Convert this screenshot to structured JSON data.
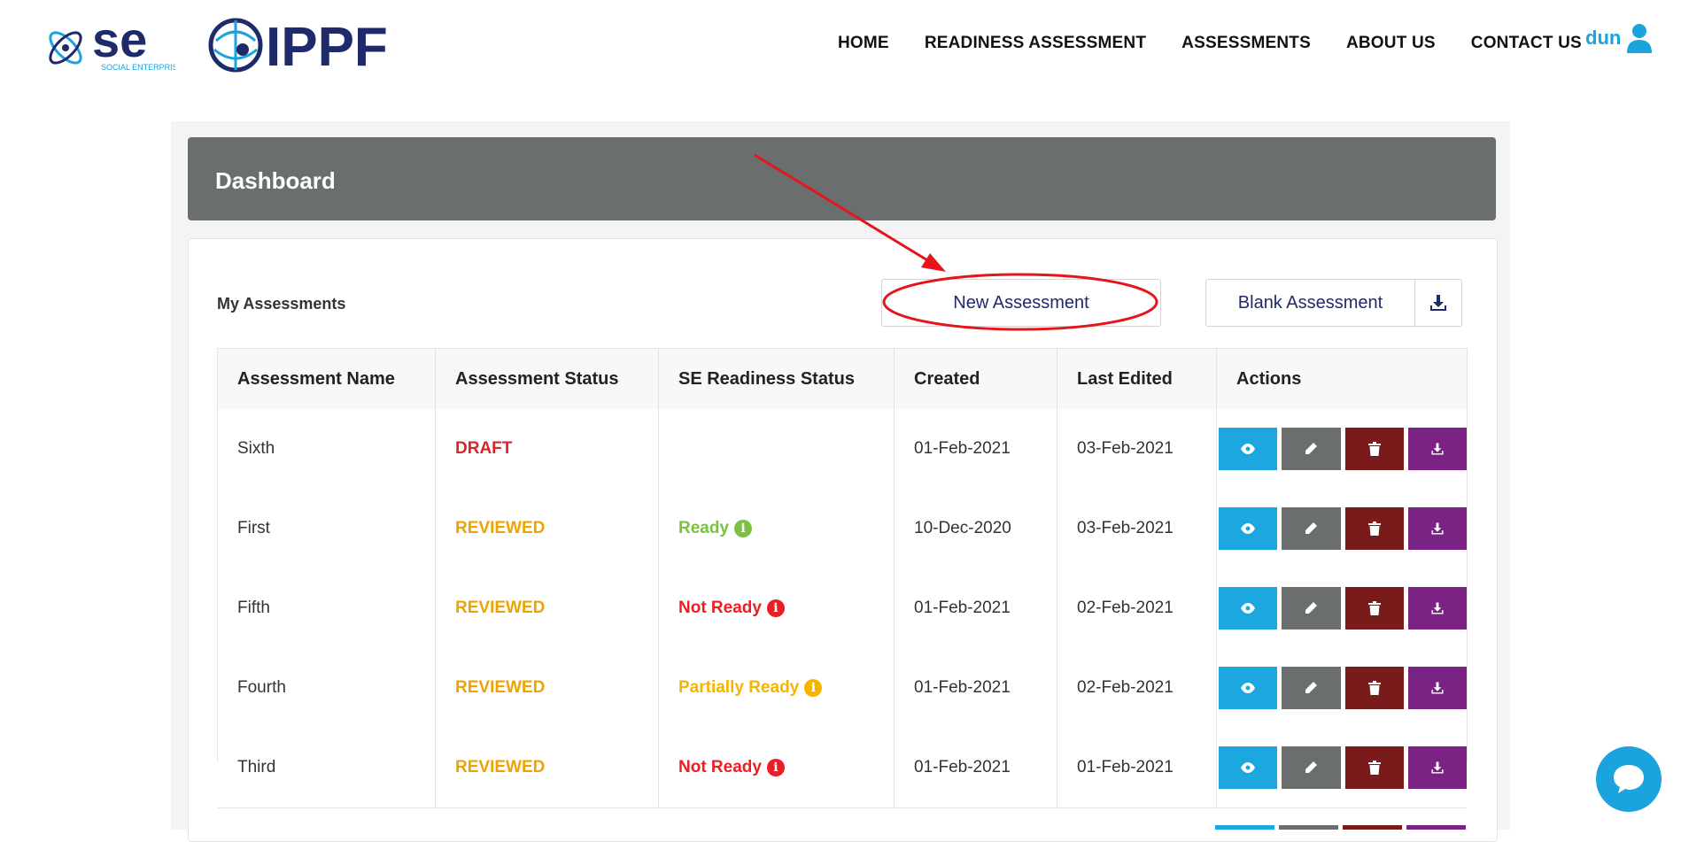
{
  "header": {
    "logo_se_text": "se",
    "logo_se_sub": "SOCIAL ENTERPRISE",
    "logo_ippf_text": "IPPF",
    "nav": [
      "HOME",
      "READINESS ASSESSMENT",
      "ASSESSMENTS",
      "ABOUT US",
      "CONTACT US"
    ],
    "user_name": "dun"
  },
  "dashboard": {
    "title": "Dashboard",
    "section_label": "My Assessments",
    "new_button": "New Assessment",
    "blank_button": "Blank Assessment"
  },
  "table": {
    "columns": [
      "Assessment Name",
      "Assessment Status",
      "SE Readiness Status",
      "Created",
      "Last Edited",
      "Actions"
    ],
    "rows": [
      {
        "name": "Sixth",
        "status": "DRAFT",
        "readiness": "",
        "created": "01-Feb-2021",
        "edited": "03-Feb-2021"
      },
      {
        "name": "First",
        "status": "REVIEWED",
        "readiness": "Ready",
        "created": "10-Dec-2020",
        "edited": "03-Feb-2021"
      },
      {
        "name": "Fifth",
        "status": "REVIEWED",
        "readiness": "Not Ready",
        "created": "01-Feb-2021",
        "edited": "02-Feb-2021"
      },
      {
        "name": "Fourth",
        "status": "REVIEWED",
        "readiness": "Partially Ready",
        "created": "01-Feb-2021",
        "edited": "02-Feb-2021"
      },
      {
        "name": "Third",
        "status": "REVIEWED",
        "readiness": "Not Ready",
        "created": "01-Feb-2021",
        "edited": "01-Feb-2021"
      }
    ]
  },
  "colors": {
    "brand_blue": "#1f2a6b",
    "accent_cyan": "#1aa3dd",
    "draft": "#d7262a",
    "reviewed": "#f0a300",
    "ready": "#7ac142",
    "not_ready": "#ee1c23",
    "partially_ready": "#f5b400",
    "annotation": "#e4151b"
  },
  "icons": {
    "view": "eye-icon",
    "edit": "pencil-icon",
    "delete": "trash-icon",
    "download": "download-icon",
    "info": "info-icon",
    "user": "user-icon",
    "chat": "chat-icon"
  }
}
